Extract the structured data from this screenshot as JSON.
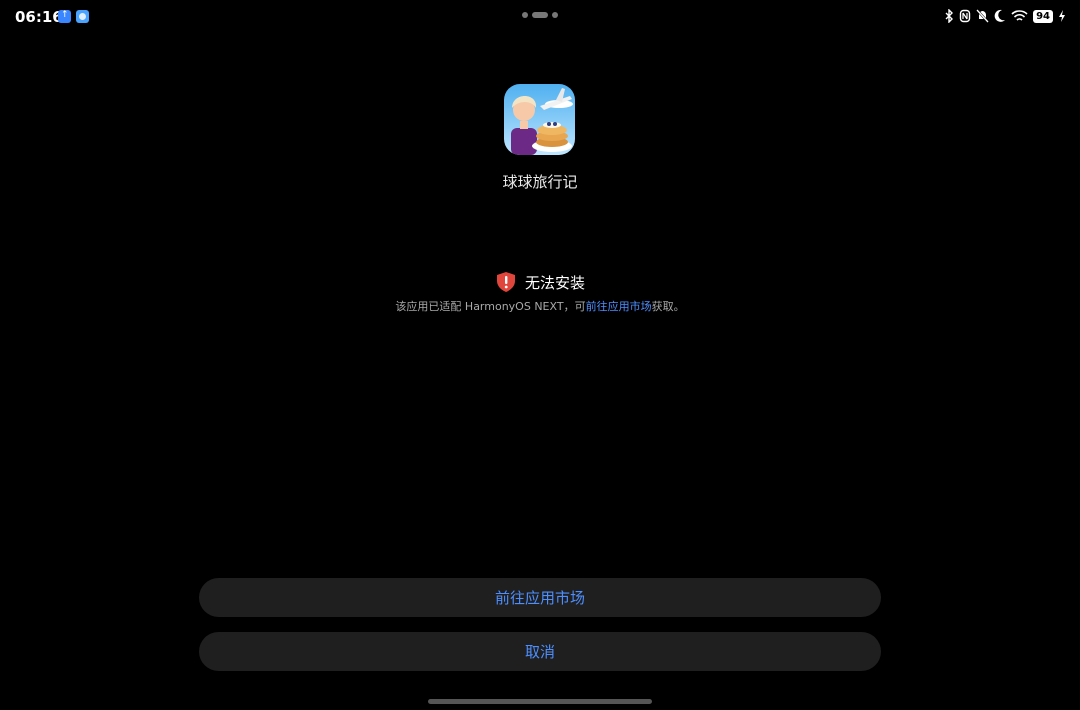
{
  "status_bar": {
    "time": "06:16",
    "battery": "94",
    "notification_icons": [
      "upload-icon",
      "browser-icon"
    ],
    "system_icons": [
      "bluetooth-icon",
      "nfc-icon",
      "mute-icon",
      "moon-icon",
      "wifi-icon",
      "battery-icon"
    ]
  },
  "app": {
    "name": "球球旅行记",
    "icon": "app-game-icon"
  },
  "error": {
    "icon": "shield-warning-icon",
    "title": "无法安装",
    "desc_prefix": "该应用已适配 HarmonyOS NEXT，可",
    "desc_link": "前往应用市场",
    "desc_suffix": "获取。"
  },
  "buttons": {
    "go_market": "前往应用市场",
    "cancel": "取消"
  },
  "colors": {
    "background": "#000000",
    "accent": "#4d8fff",
    "button_bg": "#1f1f1f",
    "warning": "#e0463c"
  }
}
